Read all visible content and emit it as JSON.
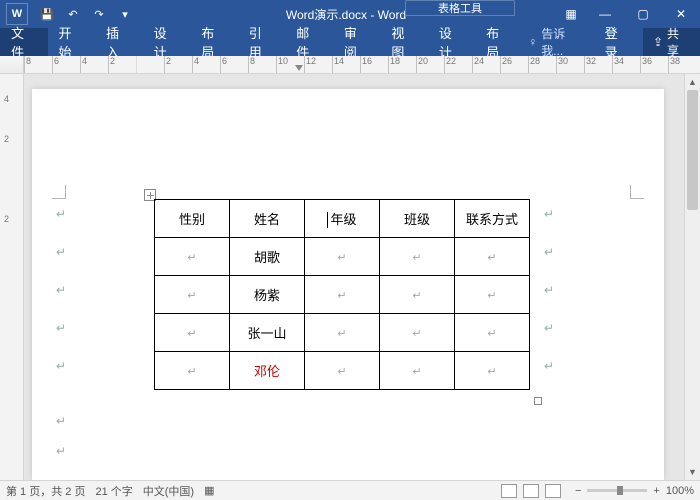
{
  "titlebar": {
    "filename": "Word演示.docx - Word",
    "qat": {
      "save": "💾",
      "undo": "↶",
      "redo": "↷",
      "more": "▾"
    },
    "win": {
      "grid_icon": "▦",
      "min": "—",
      "max": "▢",
      "close": "✕",
      "help": "?"
    },
    "context_tab_label": "表格工具"
  },
  "tabs": {
    "file": "文件",
    "items": [
      "开始",
      "插入",
      "设计",
      "布局",
      "引用",
      "邮件",
      "审阅",
      "视图"
    ],
    "context_items": [
      "设计",
      "布局"
    ],
    "tell_me_icon": "♀",
    "tell_me": "告诉我...",
    "login": "登录",
    "share_icon": "⇪",
    "share": "共享"
  },
  "ruler": {
    "hticks": [
      "8",
      "6",
      "4",
      "2",
      "",
      "2",
      "4",
      "6",
      "8",
      "10",
      "12",
      "14",
      "16",
      "18",
      "20",
      "22",
      "24",
      "26",
      "28",
      "30",
      "32",
      "34",
      "36",
      "38"
    ],
    "vticks": [
      "4",
      "2",
      "",
      "2"
    ]
  },
  "table": {
    "headers": [
      "性别",
      "姓名",
      "年级",
      "班级",
      "联系方式"
    ],
    "rows": [
      [
        "",
        "胡歌",
        "",
        "",
        ""
      ],
      [
        "",
        "杨紫",
        "",
        "",
        ""
      ],
      [
        "",
        "张一山",
        "",
        "",
        ""
      ],
      [
        "",
        "邓伦",
        "",
        "",
        ""
      ]
    ],
    "red_row": 3,
    "cursor_cell": {
      "row": -1,
      "col": 2
    }
  },
  "statusbar": {
    "page": "第 1 页，共 2 页",
    "chars": "21 个字",
    "lang": "中文(中国)",
    "zoom_minus": "−",
    "zoom_plus": "+",
    "zoom": "100%"
  }
}
